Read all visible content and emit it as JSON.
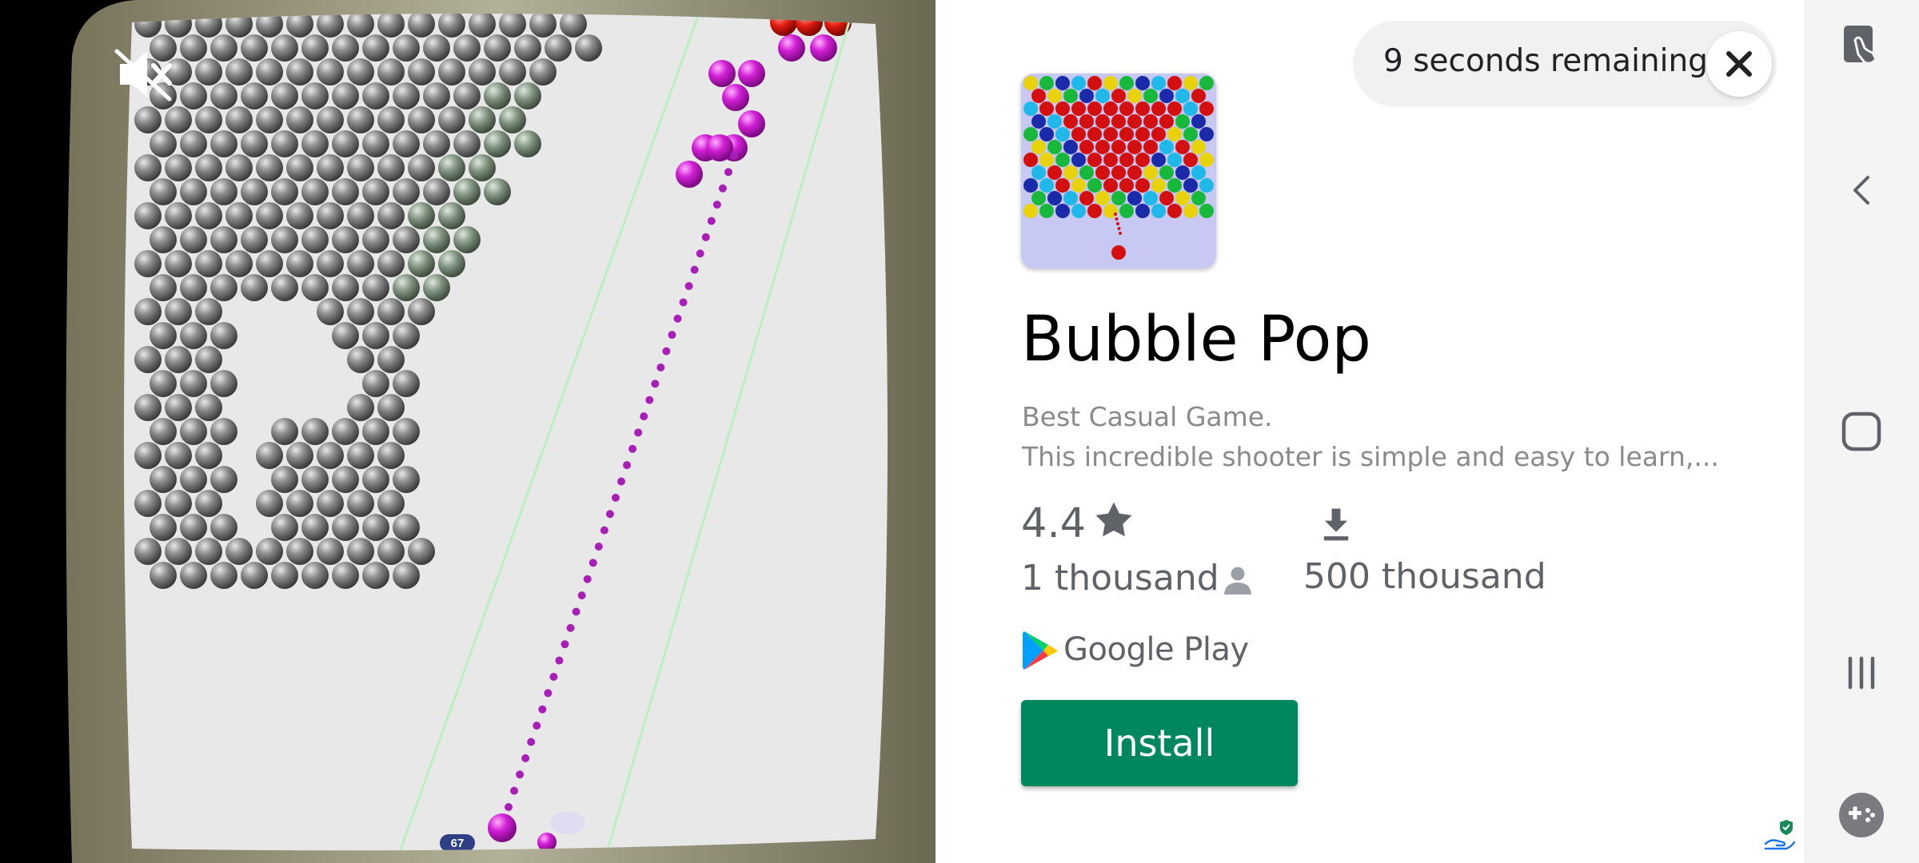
{
  "ad": {
    "timer_text": "9 seconds remaining",
    "app_title": "Bubble Pop",
    "description_line1": "Best Casual Game.",
    "description_line2": "This incredible shooter is simple and easy to learn,...",
    "rating": "4.4",
    "reviews_count": "1 thousand",
    "downloads_count": "500 thousand",
    "store_name": "Google Play",
    "install_label": "Install"
  },
  "game_preview": {
    "score_badge": "67"
  },
  "colors": {
    "install_green": "#01875f",
    "bubble_magenta": "#d21fd6",
    "bubble_gray": "#6d6d6d"
  },
  "icons": {
    "mute": "volume-off-icon",
    "close": "close-icon",
    "star": "star-icon",
    "person": "person-icon",
    "download": "download-icon",
    "store": "google-play-icon",
    "privacy": "ad-choices-icon",
    "nav": [
      "screenshot-icon",
      "back-icon",
      "home-icon",
      "recents-icon",
      "game-tools-icon"
    ]
  }
}
